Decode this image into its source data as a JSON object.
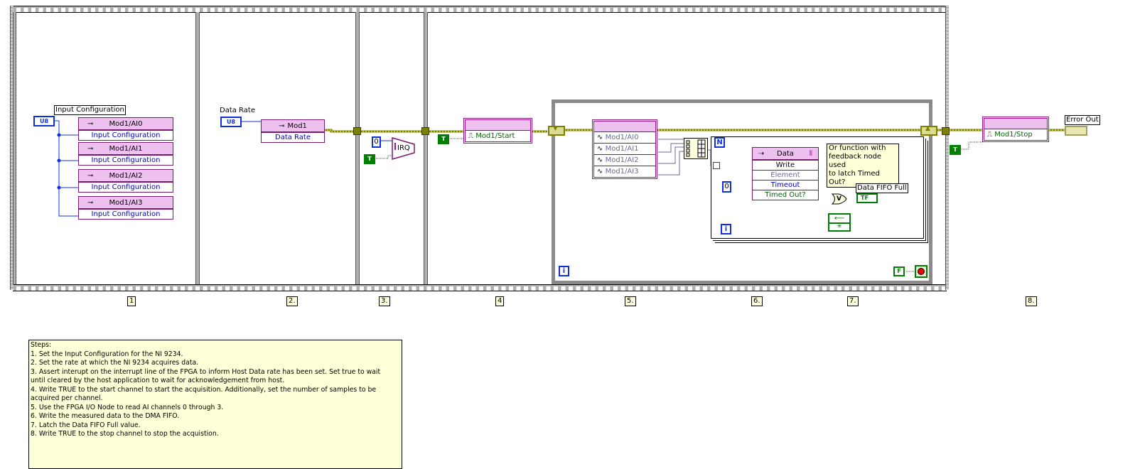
{
  "frames": {
    "labels": [
      "1",
      "2.",
      "3.",
      "4",
      "5.",
      "6.",
      "7.",
      "8."
    ]
  },
  "frame1": {
    "control_label": "Input Configuration",
    "control_type": "U8",
    "nodes": [
      {
        "title": "Mod1/AI0",
        "property": "Input Configuration"
      },
      {
        "title": "Mod1/AI1",
        "property": "Input Configuration"
      },
      {
        "title": "Mod1/AI2",
        "property": "Input Configuration"
      },
      {
        "title": "Mod1/AI3",
        "property": "Input Configuration"
      }
    ]
  },
  "frame2": {
    "control_label": "Data Rate",
    "control_type": "U8",
    "node_title": "Mod1",
    "node_property": "Data Rate"
  },
  "frame3": {
    "irq_number": "0",
    "irq_label": "IRQ",
    "wait_constant": "T"
  },
  "frame4": {
    "start_constant": "T",
    "io_node": "Mod1/Start"
  },
  "while_loop": {
    "io_nodes": [
      "Mod1/AI0",
      "Mod1/AI1",
      "Mod1/AI2",
      "Mod1/AI3"
    ],
    "iteration_label": "i",
    "stop_constant": "F",
    "for_loop": {
      "count_label": "N",
      "iteration_label": "i",
      "fifo": {
        "name": "Data",
        "method": "Write",
        "inputs": [
          "Element",
          "Timeout"
        ],
        "output": "Timed Out?"
      },
      "timeout_constant": "0",
      "or_label": "V",
      "comment": "Or function with\nfeedback node used\nto latch Timed Out?",
      "indicator_label": "Data FIFO Full",
      "indicator_type": "TF"
    }
  },
  "frame8": {
    "stop_constant": "T",
    "io_node": "Mod1/Stop",
    "error_out_label": "Error Out"
  },
  "notes": {
    "lines": [
      "Steps:",
      "1.  Set the Input Configuration for the NI 9234.",
      "2.  Set the rate at which the NI 9234 acquires data.",
      "3.  Assert interupt on the interrupt line of the FPGA to inform Host Data rate has been set. Set true to wait",
      "until cleared by the host application to wait for acknowledgement from host.",
      "4.  Write TRUE to the start channel to start the acquisition.  Additionally, set the number of samples to be",
      "acquired per channel.",
      "5.  Use the FPGA I/O Node to read AI channels 0 through 3.",
      "6.  Write the measured data to the DMA FIFO.",
      "7.  Latch the Data FIFO Full value.",
      "8.  Write TRUE to the stop channel to stop the acquistion."
    ]
  }
}
